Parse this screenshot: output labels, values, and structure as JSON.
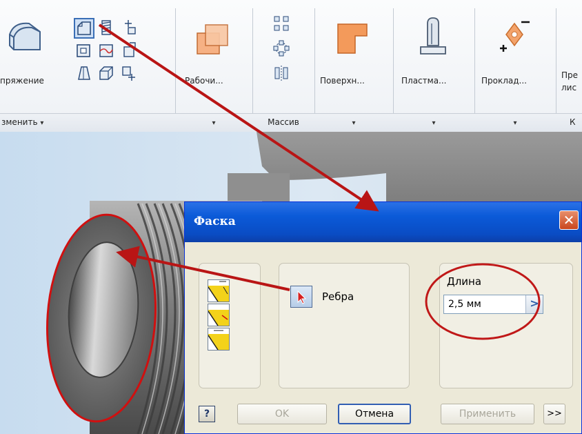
{
  "ribbon": {
    "modify_panel": {
      "partial_label": "пряжение",
      "footer_label": "зменить",
      "footer_arrow": "▾"
    },
    "work_features_panel": {
      "label": "Рабочи...",
      "footer_arrow": "▾"
    },
    "pattern_panel": {
      "footer_label": "Массив"
    },
    "surface_panel": {
      "label": "Поверхн...",
      "footer_arrow": "▾"
    },
    "plastic_panel": {
      "label": "Пластма...",
      "footer_arrow": "▾"
    },
    "harness_panel": {
      "label": "Проклад...",
      "footer_arrow": "▾"
    },
    "sheet_panel": {
      "label_line1": "Пре",
      "label_line2": "лис",
      "footer_label": "К"
    }
  },
  "dialog": {
    "title": "Фаска",
    "close_icon": "close-icon",
    "edges_label": "Ребра",
    "length_label": "Длина",
    "length_value": "2,5 мм",
    "length_arrow": ">",
    "buttons": {
      "help": "?",
      "ok": "OK",
      "cancel": "Отмена",
      "apply": "Применить",
      "more": ">>"
    }
  },
  "colors": {
    "titlebar": "#0b5ad8",
    "annotation_red": "#d01010",
    "accent_orange": "#f29a5c"
  }
}
